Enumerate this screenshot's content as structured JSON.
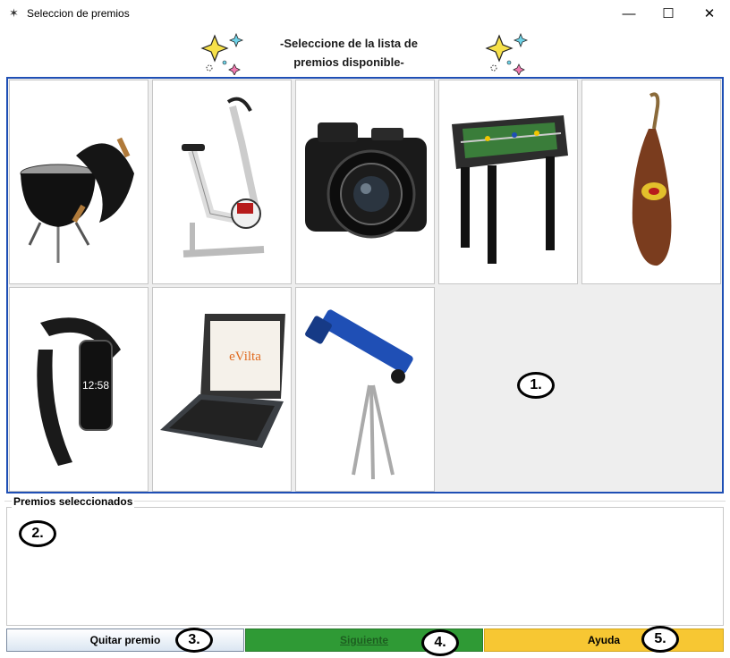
{
  "window": {
    "title": "Seleccion de premios",
    "minimize_glyph": "—",
    "maximize_glyph": "☐",
    "close_glyph": "✕"
  },
  "header": {
    "line1": "-Seleccione de la lista de",
    "line2": "premios disponible-"
  },
  "prizes": [
    {
      "icon": "barbecue-grill-icon"
    },
    {
      "icon": "exercise-bike-icon"
    },
    {
      "icon": "camera-icon"
    },
    {
      "icon": "foosball-table-icon"
    },
    {
      "icon": "ham-icon"
    },
    {
      "icon": "fitness-band-icon",
      "time": "12:58"
    },
    {
      "icon": "tablet-keyboard-icon",
      "brand": "eVilta"
    },
    {
      "icon": "telescope-icon"
    }
  ],
  "selected": {
    "legend": "Premios seleccionados",
    "items": []
  },
  "buttons": {
    "quitar": "Quitar premio",
    "siguiente": "Siguiente",
    "ayuda": "Ayuda"
  },
  "markers": {
    "m1": "1.",
    "m2": "2.",
    "m3": "3.",
    "m4": "4.",
    "m5": "5."
  },
  "colors": {
    "grid_border": "#1f4fb5",
    "siguiente_bg": "#2f9a35",
    "ayuda_bg": "#f7c733"
  }
}
